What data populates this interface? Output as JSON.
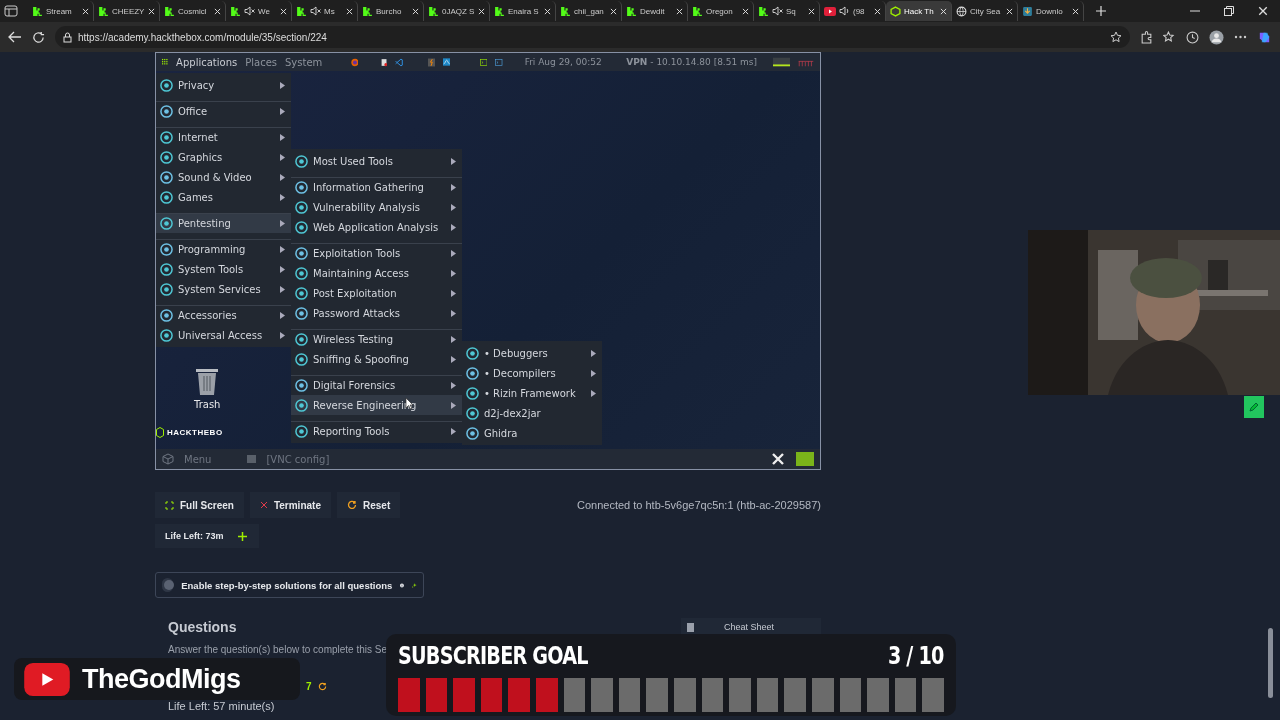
{
  "browser": {
    "tabs": [
      {
        "label": "Stream",
        "kind": "kick",
        "selected": false
      },
      {
        "label": "CHEEZY",
        "kind": "kick",
        "selected": false
      },
      {
        "label": "Cosmicl",
        "kind": "kick",
        "selected": false
      },
      {
        "label": "We",
        "kind": "kickmuted",
        "selected": false
      },
      {
        "label": "Ms",
        "kind": "kickmuted",
        "selected": false
      },
      {
        "label": "Burcho",
        "kind": "kick",
        "selected": false
      },
      {
        "label": "0JAQZ S",
        "kind": "kick",
        "selected": false
      },
      {
        "label": "Enaira S",
        "kind": "kick",
        "selected": false
      },
      {
        "label": "chii_gan",
        "kind": "kick",
        "selected": false
      },
      {
        "label": "Dewdit",
        "kind": "kick",
        "selected": false
      },
      {
        "label": "Oregon",
        "kind": "kick",
        "selected": false
      },
      {
        "label": "Sq",
        "kind": "kickmuted",
        "selected": false
      },
      {
        "label": "(98",
        "kind": "video",
        "selected": false
      },
      {
        "label": "Hack Th",
        "kind": "cube",
        "selected": true
      },
      {
        "label": "City Sea",
        "kind": "globe",
        "selected": false
      },
      {
        "label": "Downlo",
        "kind": "download",
        "selected": false
      }
    ],
    "url": "https://academy.hackthebox.com/module/35/section/224"
  },
  "vnc": {
    "top_panel": {
      "menus": [
        "Applications",
        "Places",
        "System"
      ],
      "clock": "Fri Aug 29, 00:52",
      "vpn": "**VPN** - 10.10.14.80 [8.51 ms]"
    },
    "main_menu": [
      {
        "label": "Privacy",
        "separator_before": false,
        "selected": false
      },
      {
        "label": "Office",
        "separator_before": true,
        "selected": false
      },
      {
        "label": "Internet",
        "separator_before": true,
        "selected": false
      },
      {
        "label": "Graphics",
        "separator_before": false,
        "selected": false
      },
      {
        "label": "Sound & Video",
        "separator_before": false,
        "selected": false
      },
      {
        "label": "Games",
        "separator_before": false,
        "selected": false
      },
      {
        "label": "Pentesting",
        "separator_before": true,
        "selected": true
      },
      {
        "label": "Programming",
        "separator_before": true,
        "selected": false
      },
      {
        "label": "System Tools",
        "separator_before": false,
        "selected": false
      },
      {
        "label": "System Services",
        "separator_before": false,
        "selected": false
      },
      {
        "label": "Accessories",
        "separator_before": true,
        "selected": false
      },
      {
        "label": "Universal Access",
        "separator_before": false,
        "selected": false
      }
    ],
    "pentest_menu": [
      {
        "label": "Most Used Tools",
        "separator_before": false,
        "selected": false
      },
      {
        "label": "Information Gathering",
        "separator_before": true,
        "selected": false
      },
      {
        "label": "Vulnerability Analysis",
        "separator_before": false,
        "selected": false
      },
      {
        "label": "Web Application Analysis",
        "separator_before": false,
        "selected": false
      },
      {
        "label": "Exploitation Tools",
        "separator_before": true,
        "selected": false
      },
      {
        "label": "Maintaining Access",
        "separator_before": false,
        "selected": false
      },
      {
        "label": "Post Exploitation",
        "separator_before": false,
        "selected": false
      },
      {
        "label": "Password Attacks",
        "separator_before": false,
        "selected": false
      },
      {
        "label": "Wireless Testing",
        "separator_before": true,
        "selected": false
      },
      {
        "label": "Sniffing & Spoofing",
        "separator_before": false,
        "selected": false
      },
      {
        "label": "Digital Forensics",
        "separator_before": true,
        "selected": false
      },
      {
        "label": "Reverse Engineering",
        "separator_before": false,
        "selected": true
      },
      {
        "label": "Reporting Tools",
        "separator_before": true,
        "selected": false
      }
    ],
    "reverse_menu": [
      {
        "label": "• Debuggers",
        "submenu": true,
        "selected": false
      },
      {
        "label": "• Decompilers",
        "submenu": true,
        "selected": false
      },
      {
        "label": "• Rizin Framework",
        "submenu": true,
        "selected": false
      },
      {
        "label": "d2j-dex2jar",
        "submenu": false,
        "selected": false
      },
      {
        "label": "Ghidra",
        "submenu": false,
        "selected": false
      }
    ],
    "desktop": {
      "trash": "Trash",
      "logo": "HACKTHEBO"
    },
    "bottom_panel": {
      "menu": "Menu",
      "config": "[VNC config]"
    }
  },
  "controls": {
    "buttons": [
      "Full Screen",
      "Terminate",
      "Reset"
    ],
    "connected": "Connected to htb-5v6ge7qc5n:1 (htb-ac-2029587)",
    "life_left": "Life Left: 73m"
  },
  "solutions_toggle": {
    "label": "Enable step-by-step solutions for all questions",
    "on": false
  },
  "questions": {
    "title": "Questions",
    "cheat_sheet": "Cheat Sheet",
    "intro": "Answer the question(s) below to complete this Se",
    "count": "7",
    "life_left": "Life Left: 57 minute(s)"
  },
  "overlay": {
    "channel": "TheGodMigs",
    "goal_title": "SUBSCRIBER GOAL",
    "goal_count": "3 / 10",
    "level": 0.3
  }
}
